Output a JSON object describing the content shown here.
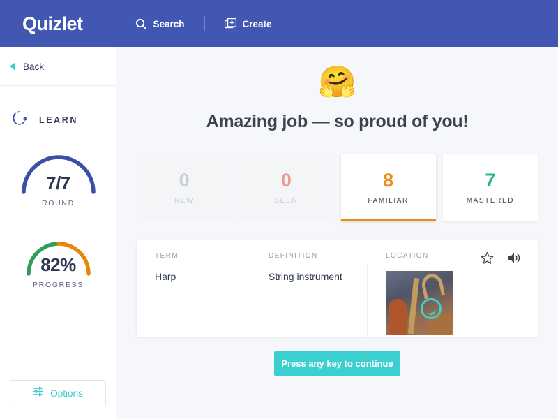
{
  "header": {
    "logo": "Quizlet",
    "search_label": "Search",
    "search_icon": "search-icon",
    "create_label": "Create",
    "create_icon": "create-card-plus-icon",
    "background_color": "#4257b2"
  },
  "sidebar": {
    "back_label": "Back",
    "back_icon": "back-triangle-icon",
    "mode_label": "LEARN",
    "mode_icon": "learn-circular-arrow-icon",
    "gauges": [
      {
        "key": "round",
        "value": "7/7",
        "caption": "ROUND",
        "fill_percent": 100,
        "colors": [
          "#3b4ea8"
        ]
      },
      {
        "key": "progress",
        "value": "82%",
        "caption": "PROGRESS",
        "fill_percent": 82,
        "colors": [
          "#2e9e5b",
          "#e8860c"
        ]
      }
    ],
    "options_label": "Options",
    "options_icon": "sliders-icon",
    "options_color": "#3ccfcf"
  },
  "main": {
    "emoji": "🤗",
    "emoji_name": "hugging-face-emoji",
    "headline": "Amazing job — so proud of you!",
    "stats": [
      {
        "value": "0",
        "label": "NEW",
        "value_color": "#ccced6",
        "label_color": "#c6c9d2",
        "state": "dim"
      },
      {
        "value": "0",
        "label": "SEEN",
        "value_color": "#ef9b93",
        "label_color": "#c6c9d2",
        "state": "dim"
      },
      {
        "value": "8",
        "label": "FAMILIAR",
        "value_color": "#ed8b16",
        "label_color": "#39444f",
        "state": "active"
      },
      {
        "value": "7",
        "label": "MASTERED",
        "value_color": "#2ab87c",
        "label_color": "#39444f",
        "state": "plain"
      }
    ],
    "term_table": {
      "headers": [
        "TERM",
        "DEFINITION",
        "LOCATION"
      ],
      "row": {
        "term": "Harp",
        "definition": "String instrument",
        "location_image": "musical-instruments-photo",
        "location_overlay_icon": "zoom-magnify-icon"
      },
      "actions": [
        {
          "name": "star-icon",
          "label": "Star"
        },
        {
          "name": "audio-speaker-icon",
          "label": "Play audio"
        }
      ]
    },
    "continue_button": "Press any key to continue",
    "continue_color": "#3ccfcf"
  }
}
